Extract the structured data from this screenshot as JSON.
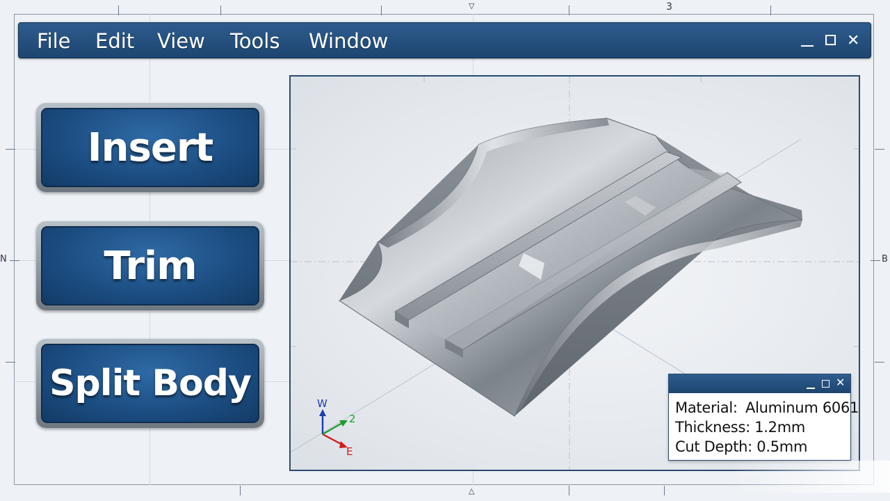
{
  "menu": {
    "items": [
      "File",
      "Edit",
      "View",
      "Tools",
      "Window"
    ]
  },
  "window_controls": {
    "minimize_icon": "minimize-icon",
    "maximize_icon": "maximize-icon",
    "close_icon": "close-icon",
    "close_glyph": "✕"
  },
  "tools": {
    "insert_label": "Insert",
    "trim_label": "Trim",
    "split_body_label": "Split Body"
  },
  "sheet": {
    "zone_top": "3",
    "zone_left": "N",
    "zone_right": "B"
  },
  "axes": {
    "up_label": "W",
    "depth_label": "2",
    "right_label": "E",
    "colors": {
      "up": "#1a3db0",
      "depth": "#1f9b2e",
      "right": "#d21c1c"
    }
  },
  "properties": {
    "close_glyph": "✕",
    "material_label": "Material:",
    "material_value": "Aluminum 6061",
    "thickness_text": "Thickness: 1.2mm",
    "cut_depth_text": "Cut Depth: 0.5mm"
  },
  "colors": {
    "toolbar_blue": "#1d456f",
    "button_blue": "#1b4c80",
    "frame_border": "#2a4a6e"
  }
}
